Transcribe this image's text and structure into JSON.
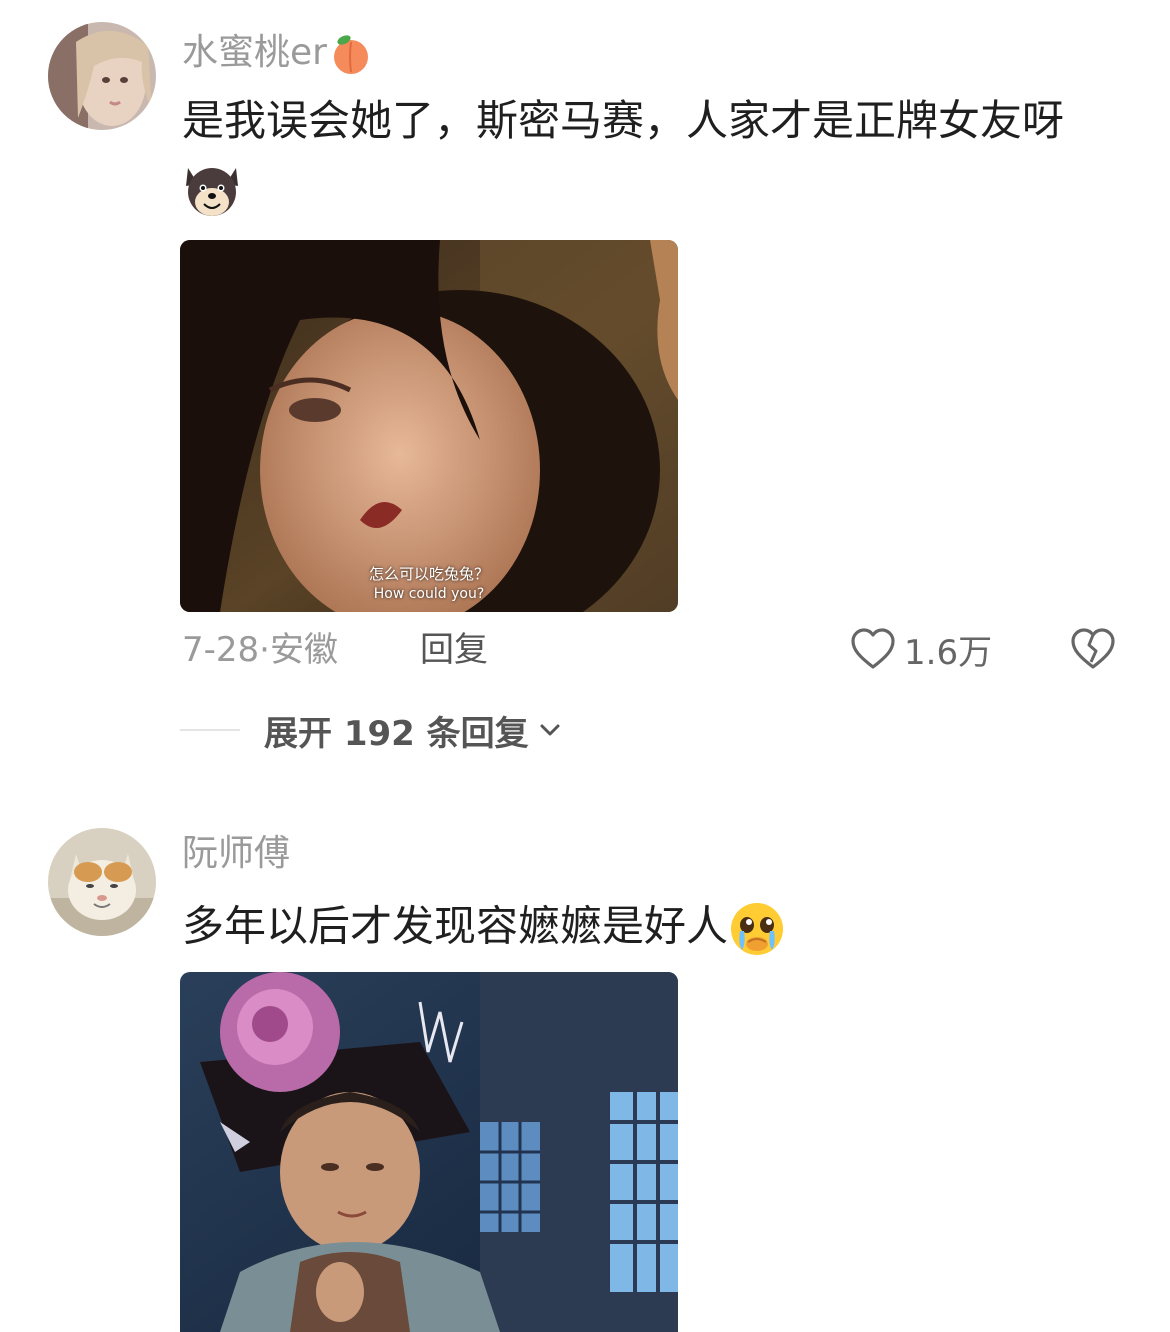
{
  "comments": [
    {
      "username": "水蜜桃er",
      "username_emoji": "peach-emoji",
      "text": "是我误会她了，斯密马赛，人家才是正牌女友呀",
      "inline_sticker": "dog-face-sticker",
      "media": {
        "subtitle_zh": "怎么可以吃兔兔？",
        "subtitle_en": "How could you?"
      },
      "date": "7-28",
      "location": "安徽",
      "reply_label": "回复",
      "like_count": "1.6万",
      "expand_label": "展开 192 条回复"
    },
    {
      "username": "阮师傅",
      "text": "多年以后才发现容嬷嬷是好人",
      "inline_emoji": "pleading-tears-emoji"
    }
  ],
  "colors": {
    "username": "#9a9a9a",
    "text": "#1f1f1f",
    "meta": "#9a9a9a",
    "action": "#555555"
  }
}
